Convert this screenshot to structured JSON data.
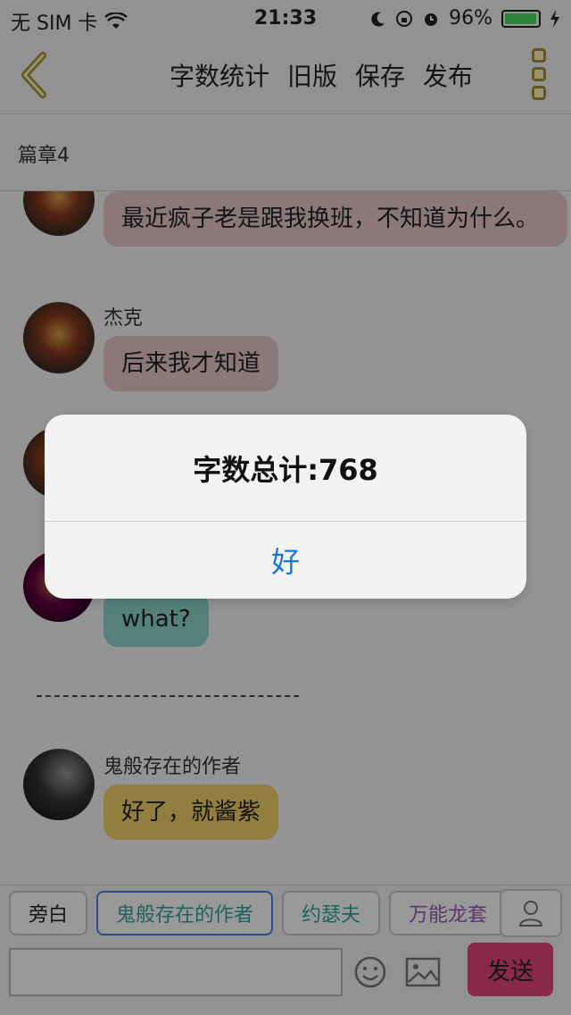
{
  "status_bar": {
    "carrier": "无 SIM 卡",
    "time": "21:33",
    "battery_percent": "96%",
    "battery_level": 0.96
  },
  "nav": {
    "actions": [
      "字数统计",
      "旧版",
      "保存",
      "发布"
    ]
  },
  "chapter": {
    "title": "篇章4"
  },
  "messages": [
    {
      "name": "",
      "text": "最近疯子老是跟我换班，不知道为什么。",
      "color": "#e8c9cc"
    },
    {
      "name": "杰克",
      "text": "后来我才知道",
      "color": "#e8c9cc"
    },
    {
      "name": "",
      "text": "what?",
      "color": "#8fd6cc"
    },
    {
      "name": "鬼般存在的作者",
      "text": "好了，就酱紫",
      "color": "#f4d36a"
    }
  ],
  "divider": "------------------------------",
  "composer": {
    "roles": [
      "旁白",
      "鬼般存在的作者",
      "约瑟夫",
      "万能龙套"
    ],
    "send_label": "发送"
  },
  "alert": {
    "message": "字数总计:768",
    "ok_label": "好"
  }
}
